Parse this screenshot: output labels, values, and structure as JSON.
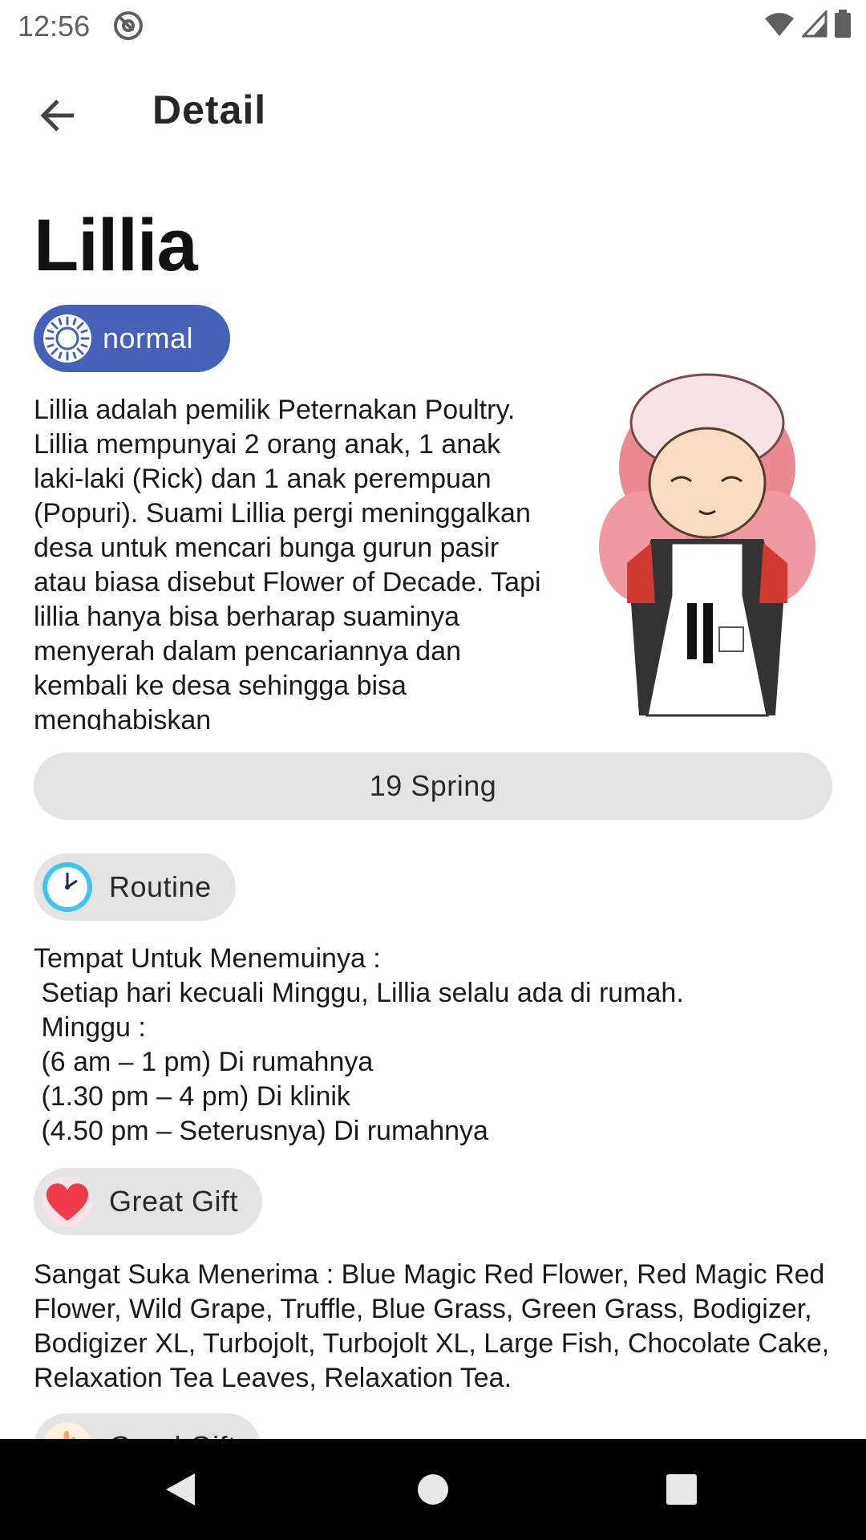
{
  "status_bar": {
    "time": "12:56"
  },
  "app_bar": {
    "title": "Detail"
  },
  "villager": {
    "name": "Lillia",
    "type_label": "normal",
    "description": "Lillia adalah pemilik Peternakan Poultry. Lillia mempunyai 2 orang anak, 1 anak laki-laki (Rick) dan 1 anak perempuan (Popuri). Suami Lillia pergi meninggalkan desa untuk mencari bunga gurun pasir atau biasa disebut Flower of Decade. Tapi lillia hanya bisa berharap suaminya menyerah dalam pencariannya dan kembali ke desa sehingga bisa menghabiskan",
    "birthday": "19 Spring"
  },
  "routine": {
    "label": "Routine",
    "text": "Tempat Untuk Menemuinya :\n Setiap hari kecuali Minggu, Lillia selalu ada di rumah.\n Minggu :\n (6 am – 1 pm) Di rumahnya\n (1.30 pm – 4 pm) Di klinik\n (4.50 pm – Seterusnya) Di rumahnya"
  },
  "great_gift": {
    "label": "Great Gift",
    "text": "Sangat Suka Menerima : Blue Magic Red Flower, Red Magic Red Flower, Wild Grape, Truffle, Blue Grass, Green Grass, Bodigizer, Bodigizer XL, Turbojolt, Turbojolt XL, Large Fish, Chocolate Cake, Relaxation Tea Leaves, Relaxation Tea."
  },
  "good_gift": {
    "label": "Good Gift"
  },
  "colors": {
    "type_chip": "#4561b8",
    "pill_bg": "#e4e4e4",
    "nav_bar": "#000000"
  },
  "icons": {
    "back": "arrow-back-icon",
    "type": "sun-icon",
    "routine": "clock-icon",
    "great_gift": "heart-icon",
    "good_gift": "hand-icon"
  }
}
